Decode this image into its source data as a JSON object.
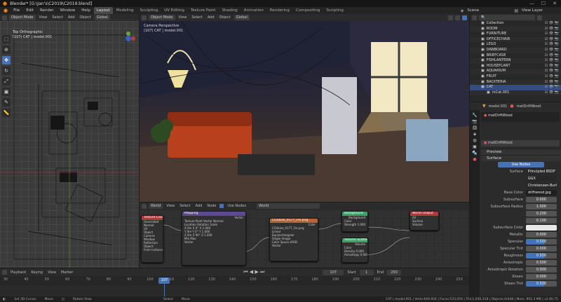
{
  "window": {
    "title": "Blender* [G:\\Jan's\\C2019\\C2019.blend]"
  },
  "menu": {
    "items": [
      "File",
      "Edit",
      "Render",
      "Window",
      "Help"
    ],
    "workspaces": [
      "Layout",
      "Modeling",
      "Sculpting",
      "UV Editing",
      "Texture Paint",
      "Shading",
      "Animation",
      "Rendering",
      "Compositing",
      "Scripting"
    ],
    "scene_label": "Scene",
    "view_layer_label": "View Layer"
  },
  "viewport_left": {
    "mode": "Object Mode",
    "menus": [
      "View",
      "Select",
      "Add",
      "Object"
    ],
    "orientation": "Global",
    "overlay_title": "Top Orthographic",
    "overlay_sub": "(107) CAT | model.001"
  },
  "viewport_main": {
    "mode": "Object Mode",
    "menus": [
      "View",
      "Select",
      "Add",
      "Object"
    ],
    "orientation": "Global",
    "overlay_title": "Camera Perspective",
    "overlay_sub": "(107) CAT | model.001"
  },
  "node_editor": {
    "world": "World",
    "menus": [
      "View",
      "Select",
      "Add",
      "Node"
    ],
    "use_nodes": "Use Nodes",
    "world_name": "World",
    "nodes": {
      "texcoord": {
        "title": "Texture Coordinate",
        "rows": [
          "Generated",
          "Normal",
          "UV",
          "Object",
          "Camera",
          "Window",
          "Reflection",
          "Object:",
          "From Instancer"
        ],
        "color": "#b33a3a"
      },
      "mapping": {
        "title": "Mapping",
        "rows": [
          "Vector",
          "Texture  Point  Vector  Normal",
          "Location    Rotation    Scale",
          "X 0m    X 0°    X 1.000",
          "Y 0m    Y 0°    Y 1.000",
          "Z 0m    Z 90°   Z 1.000",
          "Min    Max",
          "Vector"
        ],
        "color": "#5d4a8f"
      },
      "envtex": {
        "title": "CGSkies_0177_Fre.png",
        "rows": [
          "Color",
          "CGSkies_0177_Fre.png",
          "Linear",
          "Equirectangular",
          "Single Image",
          "Color Space    sRGB",
          "Vector"
        ],
        "color": "#b5633a"
      },
      "background": {
        "title": "Background",
        "rows": [
          "Background",
          "Color",
          "Strength    1.000"
        ],
        "color": "#3aa366"
      },
      "volume": {
        "title": "Volume Scatter",
        "rows": [
          "Volume",
          "Color",
          "Density    0.000",
          "Anisotropy   0.000"
        ],
        "color": "#3aa366"
      },
      "output": {
        "title": "World Output",
        "rows": [
          "All",
          "Surface",
          "Volume"
        ],
        "color": "#b33a3a"
      }
    }
  },
  "timeline": {
    "menus": [
      "Playback",
      "Keying",
      "View",
      "Marker"
    ],
    "current_frame": "107",
    "start_label": "Start",
    "start": "1",
    "end_label": "End",
    "end": "250",
    "ticks": [
      "30",
      "40",
      "50",
      "60",
      "70",
      "80",
      "90",
      "100",
      "110",
      "120",
      "130",
      "140",
      "150",
      "160",
      "170",
      "180",
      "190",
      "200",
      "210",
      "220",
      "230",
      "240",
      "250"
    ]
  },
  "statusbar": {
    "items": [
      "Set 3D Cursor",
      "Move",
      "Rotate View",
      "Select",
      "Move"
    ],
    "stats": "CAT | model.001 | Verts:649,924 | Faces:533,059 | Tris:1,030,318 | Objects:0/448 | Mem: 992.3 MB | v2.80.75"
  },
  "outliner": {
    "items": [
      {
        "name": "Collection",
        "sel": false
      },
      {
        "name": "ROOM",
        "sel": false
      },
      {
        "name": "FURNITURE",
        "sel": false
      },
      {
        "name": "OFFICECHAIR",
        "sel": false
      },
      {
        "name": "LEGO",
        "sel": false
      },
      {
        "name": "DANBOARD",
        "sel": false
      },
      {
        "name": "BRIEFCASE",
        "sel": false
      },
      {
        "name": "FISHLANTERN",
        "sel": false
      },
      {
        "name": "HOUSEPLANT",
        "sel": false
      },
      {
        "name": "AQUARIUM",
        "sel": false
      },
      {
        "name": "FRUIT",
        "sel": false
      },
      {
        "name": "BACKTERIA",
        "sel": false
      },
      {
        "name": "CAT",
        "sel": true
      },
      {
        "name": "mCat.001",
        "sel": false
      }
    ]
  },
  "properties": {
    "object": "model.001",
    "material": "matDriftWood",
    "slot": "matDriftWood",
    "material_field": "matDriftWood",
    "panels": {
      "preview": "Preview",
      "surface": "Surface"
    },
    "use_nodes": "Use Nodes",
    "rows": [
      {
        "label": "Surface",
        "value": "Principled BSDF",
        "kind": "drop"
      },
      {
        "label": "",
        "value": "GGX",
        "kind": "drop"
      },
      {
        "label": "",
        "value": "Christensen-Burley",
        "kind": "drop"
      },
      {
        "label": "Base Color",
        "value": "driftwood.jpg",
        "kind": "dark"
      },
      {
        "label": "Subsurface",
        "value": "0.000",
        "kind": "num"
      },
      {
        "label": "Subsurface Radius",
        "value": "1.000",
        "kind": "num"
      },
      {
        "label": "",
        "value": "0.200",
        "kind": "num"
      },
      {
        "label": "",
        "value": "0.100",
        "kind": "num"
      },
      {
        "label": "Subsurface Color",
        "value": "",
        "kind": "color"
      },
      {
        "label": "Metallic",
        "value": "0.000",
        "kind": "num"
      },
      {
        "label": "Specular",
        "value": "0.500",
        "kind": "blue"
      },
      {
        "label": "Specular Tint",
        "value": "0.000",
        "kind": "num"
      },
      {
        "label": "Roughness",
        "value": "0.500",
        "kind": "blue"
      },
      {
        "label": "Anisotropic",
        "value": "0.000",
        "kind": "num"
      },
      {
        "label": "Anisotropic Rotation",
        "value": "0.000",
        "kind": "num"
      },
      {
        "label": "Sheen",
        "value": "0.000",
        "kind": "num"
      },
      {
        "label": "Sheen Tint",
        "value": "0.500",
        "kind": "blue"
      }
    ]
  },
  "colors": {
    "accent": "#4772b3",
    "timeline_cursor": "#4772b3"
  }
}
